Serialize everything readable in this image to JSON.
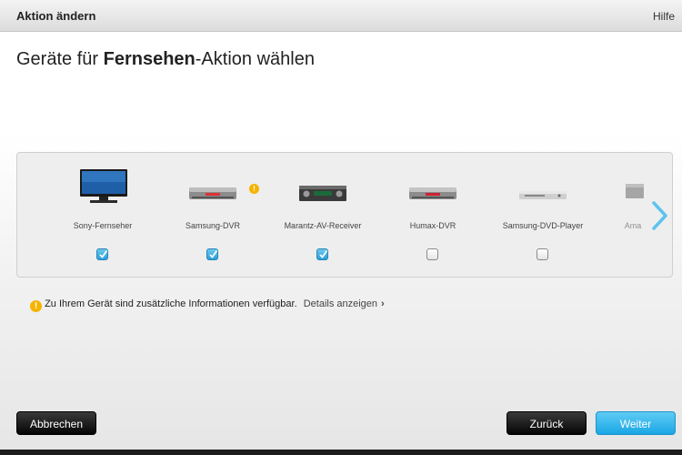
{
  "dialog": {
    "title": "Aktion ändern",
    "help_label": "Hilfe",
    "heading_prefix": "Geräte für ",
    "heading_bold": "Fernsehen",
    "heading_suffix": "-Aktion wählen"
  },
  "devices": [
    {
      "label": "Sony-Fernseher",
      "icon": "tv-icon",
      "checked": true
    },
    {
      "label": "Samsung-DVR",
      "icon": "dvr-icon",
      "checked": true,
      "warning": true
    },
    {
      "label": "Marantz-AV-Receiver",
      "icon": "av-receiver-icon",
      "checked": true
    },
    {
      "label": "Humax-DVR",
      "icon": "dvr-icon",
      "checked": false
    },
    {
      "label": "Samsung-DVD-Player",
      "icon": "dvd-player-icon",
      "checked": false
    },
    {
      "label": "Ama",
      "icon": "device-icon",
      "checked": false
    }
  ],
  "info": {
    "icon": "!",
    "text": "Zu Ihrem Gerät sind zusätzliche Informationen verfügbar.",
    "link": "Details anzeigen",
    "link_chevron": "›"
  },
  "buttons": {
    "cancel": "Abbrechen",
    "back": "Zurück",
    "next": "Weiter"
  },
  "colors": {
    "accent_blue": "#2aa8e0",
    "warning": "#f5b400",
    "dark_button": "#111111"
  }
}
